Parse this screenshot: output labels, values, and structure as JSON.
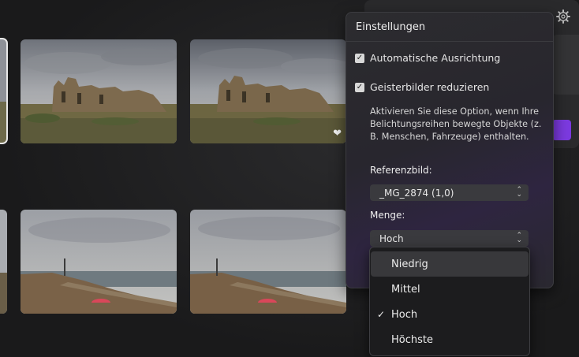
{
  "settings": {
    "title": "Einstellungen",
    "auto_align_label": "Automatische Ausrichtung",
    "auto_align_checked": true,
    "deghost_label": "Geisterbilder reduzieren",
    "deghost_checked": true,
    "deghost_help": "Aktivieren Sie diese Option, wenn Ihre Belichtungsreihen bewegte Objekte (z. B. Menschen, Fahrzeuge) enthalten.",
    "reference_label": "Referenzbild:",
    "reference_value": "_MG_2874 (1,0)",
    "amount_label": "Menge:",
    "amount_value": "Hoch"
  },
  "amount_options": [
    {
      "label": "Niedrig",
      "selected": false,
      "hovered": true
    },
    {
      "label": "Mittel",
      "selected": false,
      "hovered": false
    },
    {
      "label": "Hoch",
      "selected": true,
      "hovered": false
    },
    {
      "label": "Höchste",
      "selected": false,
      "hovered": false
    }
  ],
  "check_glyph": "✓",
  "thumbnails": [
    {
      "subject": "ruins",
      "selected": true,
      "favorite": false
    },
    {
      "subject": "ruins",
      "selected": false,
      "favorite": false
    },
    {
      "subject": "ruins",
      "selected": false,
      "favorite": true
    },
    {
      "subject": "beach",
      "selected": false,
      "favorite": false
    },
    {
      "subject": "beach",
      "selected": false,
      "favorite": false
    },
    {
      "subject": "beach",
      "selected": false,
      "favorite": false
    }
  ],
  "icons": {
    "settings": "gear-icon",
    "favorite": "heart-icon",
    "select_chevron": "chevron-up-down-icon"
  },
  "colors": {
    "accent": "#7c3ae0",
    "panel_bg": "#2c2c2f",
    "dropdown_bg": "#1c1c1e"
  }
}
